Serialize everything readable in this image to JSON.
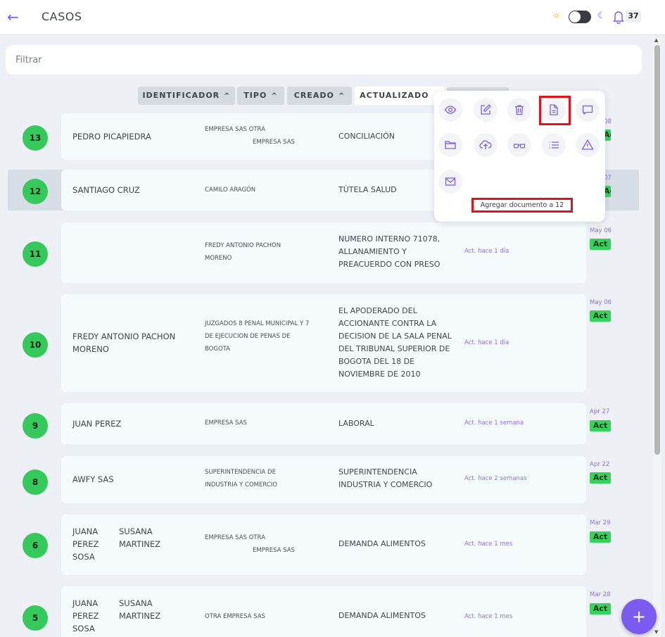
{
  "header": {
    "title": "CASOS",
    "notification_count": "37"
  },
  "filter": {
    "placeholder": "Filtrar"
  },
  "sort": [
    "IDENTIFICADOR",
    "TIPO",
    "CREADO",
    "ACTUALIZADO"
  ],
  "cases": [
    {
      "id": "13",
      "name": "PEDRO PICAPIEDRA",
      "empresa": [
        "EMPRESA SAS OTRA",
        "EMPRESA SAS"
      ],
      "tipo": "CONCILIACIÓN",
      "act": "",
      "date": "08",
      "badge": "Act"
    },
    {
      "id": "12",
      "name": "SANTIAGO CRUZ",
      "empresa": [
        "CAMILO ARAGÓN"
      ],
      "tipo": "TÚTELA SALUD",
      "act": "",
      "date": "07",
      "badge": "Act"
    },
    {
      "id": "11",
      "name": "",
      "empresa": [
        "FREDY ANTONIO PACHON",
        "MORENO"
      ],
      "tipo": "NUMERO INTERNO 71078, ALLANAMIENTO Y PREACUERDO CON PRESO",
      "act": "Act. hace 1 día",
      "date": "May 06",
      "badge": "Act"
    },
    {
      "id": "10",
      "name": "FREDY ANTONIO PACHON MORENO",
      "empresa": [
        "JUZGADOS 8 PENAL MUNICIPAL Y 7 DE EJECUCION DE PENAS DE BOGOTA"
      ],
      "tipo": "EL APODERADO DEL ACCIONANTE CONTRA LA DECISION DE LA SALA PENAL DEL TRIBUNAL SUPERIOR DE BOGOTA DEL 18 DE NOVIEMBRE DE 2010",
      "act": "Act. hace 1 día",
      "date": "May 06",
      "badge": "Act"
    },
    {
      "id": "9",
      "name": "JUAN PEREZ",
      "empresa": [
        "EMPRESA SAS"
      ],
      "tipo": "LABORAL",
      "act": "Act. hace 1 semana",
      "date": "Apr 27",
      "badge": "Act"
    },
    {
      "id": "8",
      "name": "AWFY SAS",
      "empresa": [
        "SUPERINTENDENCIA DE INDUSTRIA Y COMERCIO"
      ],
      "tipo": "SUPERINTENDENCIA INDUSTRIA Y COMERCIO",
      "act": "Act. hace 2 semanas",
      "date": "Apr 22",
      "badge": "Act"
    },
    {
      "id": "6",
      "name_parts": [
        "JUANA PEREZ SOSA",
        "SUSANA MARTINEZ"
      ],
      "empresa": [
        "EMPRESA SAS OTRA",
        "EMPRESA SAS"
      ],
      "tipo": "DEMANDA ALIMENTOS",
      "act": "Act. hace 1 mes",
      "date": "Mar 29",
      "badge": "Act"
    },
    {
      "id": "5",
      "name_parts": [
        "JUANA PEREZ SOSA",
        "SUSANA MARTINEZ"
      ],
      "empresa": [
        "OTRA EMPRESA SAS"
      ],
      "tipo": "DEMANDA ALIMENTOS",
      "act": "Act. hace 1 mes",
      "date": "Mar 28",
      "badge": "Act"
    }
  ],
  "popup": {
    "actions": [
      "view-icon",
      "edit-icon",
      "delete-icon",
      "add-document-icon",
      "comment-icon",
      "folder-icon",
      "upload-icon",
      "glasses-icon",
      "list-icon",
      "warning-icon",
      "mail-icon"
    ],
    "tooltip": "Agregar documento a 12"
  },
  "colors": {
    "accent": "#7c5cf0",
    "status_green": "#34c95a",
    "highlight_red": "#e0131b"
  }
}
